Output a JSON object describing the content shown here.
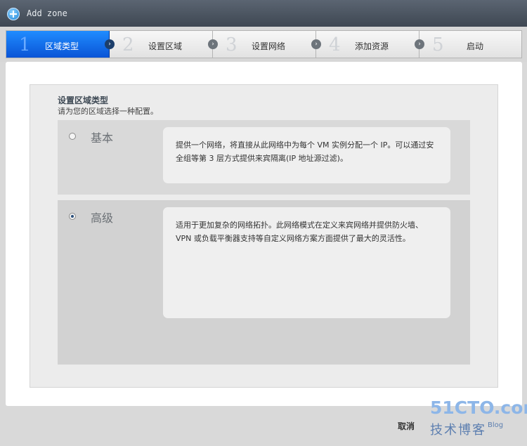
{
  "window": {
    "title": "Add zone"
  },
  "steps": [
    {
      "number": "1",
      "label": "区域类型",
      "active": true
    },
    {
      "number": "2",
      "label": "设置区域",
      "active": false
    },
    {
      "number": "3",
      "label": "设置网络",
      "active": false
    },
    {
      "number": "4",
      "label": "添加资源",
      "active": false
    },
    {
      "number": "5",
      "label": "启动",
      "active": false
    }
  ],
  "panel": {
    "title": "设置区域类型",
    "subtitle": "请为您的区域选择一种配置。"
  },
  "options": {
    "basic": {
      "label": "基本",
      "selected": false,
      "description": "提供一个网络，将直接从此网络中为每个 VM 实例分配一个 IP。可以通过安全组等第 3 层方式提供来宾隔离(IP 地址源过滤)。"
    },
    "advanced": {
      "label": "高级",
      "selected": true,
      "description": "适用于更加复杂的网络拓扑。此网络模式在定义来宾网络并提供防火墙、VPN 或负载平衡器支持等自定义网络方案方面提供了最大的灵活性。"
    }
  },
  "footer": {
    "cancel_label": "取消"
  },
  "watermark": {
    "line1": "51CTO.com",
    "line2": "技术博客",
    "line3": "Blog"
  }
}
